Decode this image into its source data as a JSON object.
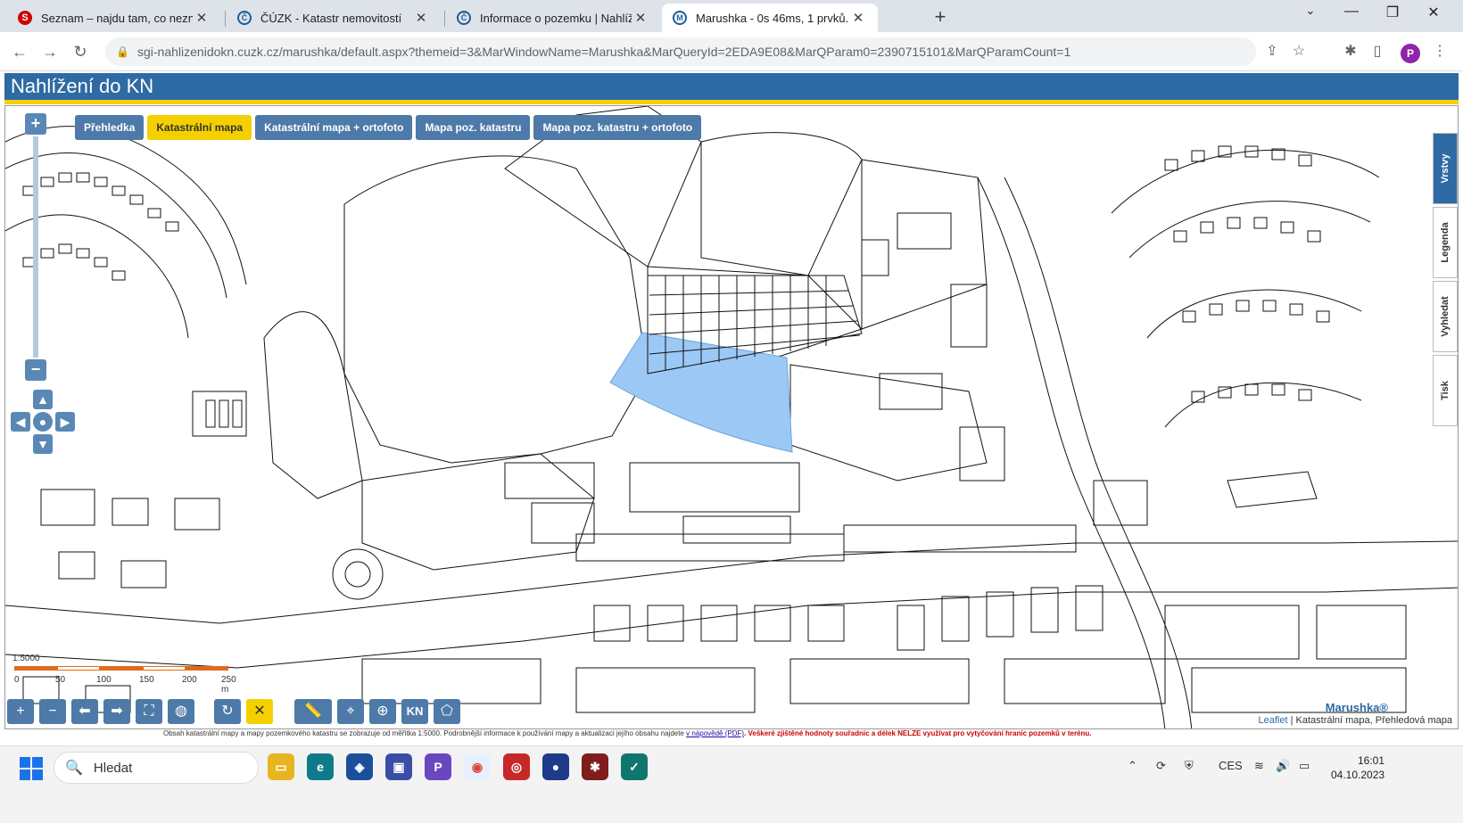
{
  "browser": {
    "tabs": [
      {
        "title": "Seznam – najdu tam, co neznám",
        "icon": "seznam-icon"
      },
      {
        "title": "ČÚZK - Katastr nemovitostí",
        "icon": "cuzk-icon"
      },
      {
        "title": "Informace o pozemku | Nahlížen",
        "icon": "cuzk-icon"
      },
      {
        "title": "Marushka - 0s 46ms, 1 prvků.",
        "icon": "marushka-icon"
      }
    ],
    "url": "sgi-nahlizenidokn.cuzk.cz/marushka/default.aspx?themeid=3&MarWindowName=Marushka&MarQueryId=2EDA9E08&MarQParam0=2390715101&MarQParamCount=1",
    "profile_initial": "P"
  },
  "page": {
    "title": "Nahlížení do KN",
    "map_tabs": [
      "Přehledka",
      "Katastrální mapa",
      "Katastrální mapa + ortofoto",
      "Mapa poz. katastru",
      "Mapa poz. katastru + ortofoto"
    ],
    "selected_map_tab": "Katastrální mapa",
    "side_tabs": [
      "Vrstvy",
      "Legenda",
      "Vyhledat",
      "Tisk"
    ],
    "scale": {
      "ratio": "1:5000",
      "ticks": [
        "0",
        "50",
        "100",
        "150",
        "200",
        "250 m"
      ]
    },
    "attribution": {
      "leaflet": "Leaflet",
      "text": "| Katastrální mapa, Přehledová mapa"
    },
    "brand": "Marushka®",
    "footnote": {
      "text": "Obsah katastrální mapy a mapy pozemkového katastru se zobrazuje od měřítka 1:5000. Podrobnější informace k používání mapy a aktualizaci jejího obsahu najdete",
      "link": "v nápovědě (PDF)",
      "warning": ". Veškeré zjištěné hodnoty souřadnic a délek NELZE využívat pro vytyčování hranic pozemků v terénu."
    },
    "toolbar_kn": "KN",
    "colors": {
      "header": "#2e6aa3",
      "stripe": "#f5d000",
      "parcel_highlight": "#9cc8f5"
    }
  },
  "taskbar": {
    "search_placeholder": "Hledat",
    "language": "CES",
    "time": "16:01",
    "date": "04.10.2023"
  }
}
